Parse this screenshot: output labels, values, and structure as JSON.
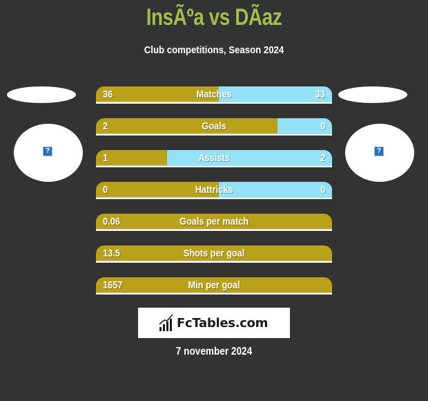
{
  "header": {
    "title": "InsÃºa vs DÃaz",
    "subtitle": "Club competitions, Season 2024"
  },
  "players": {
    "left": {
      "avatar_icon": "missing-image-icon",
      "avatar_glyph": "?"
    },
    "right": {
      "avatar_icon": "missing-image-icon",
      "avatar_glyph": "?"
    }
  },
  "colors": {
    "left_bar": "#b9a21a",
    "right_bar": "#94e1f8",
    "title": "#a3bd4e",
    "background": "#333333"
  },
  "stats": [
    {
      "label": "Matches",
      "left": "36",
      "right": "33",
      "left_share": 0.52
    },
    {
      "label": "Goals",
      "left": "2",
      "right": "0",
      "left_share": 0.77
    },
    {
      "label": "Assists",
      "left": "1",
      "right": "2",
      "left_share": 0.3
    },
    {
      "label": "Hattricks",
      "left": "0",
      "right": "0",
      "left_share": 0.52
    },
    {
      "label": "Goals per match",
      "left": "0.06",
      "right": "",
      "left_share": 1.0
    },
    {
      "label": "Shots per goal",
      "left": "13.5",
      "right": "",
      "left_share": 1.0
    },
    {
      "label": "Min per goal",
      "left": "1657",
      "right": "",
      "left_share": 1.0
    }
  ],
  "footer": {
    "logo_text": "FcTables.com",
    "logo_icon": "bar-chart-icon",
    "date": "7 november 2024"
  }
}
